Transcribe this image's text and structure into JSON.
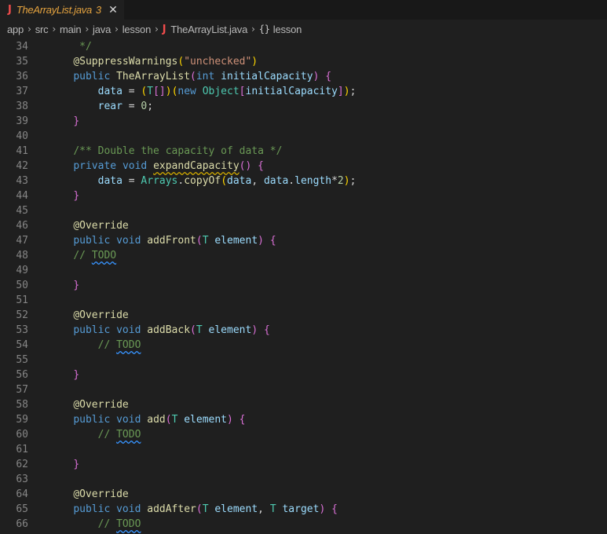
{
  "tab": {
    "icon": "J",
    "title": "TheArrayList.java",
    "problems": "3",
    "close": "✕"
  },
  "breadcrumb": {
    "segments": [
      "app",
      "src",
      "main",
      "java",
      "lesson"
    ],
    "file_icon": "J",
    "file": "TheArrayList.java",
    "symbol_icon": "{}",
    "symbol": "lesson"
  },
  "editor": {
    "lines": [
      {
        "n": "34",
        "t": "     */"
      },
      {
        "n": "35",
        "t": "    @SuppressWarnings(\"unchecked\")"
      },
      {
        "n": "36",
        "t": "    public TheArrayList(int initialCapacity) {"
      },
      {
        "n": "37",
        "t": "        data = (T[])(new Object[initialCapacity]);"
      },
      {
        "n": "38",
        "t": "        rear = 0;"
      },
      {
        "n": "39",
        "t": "    }"
      },
      {
        "n": "40",
        "t": ""
      },
      {
        "n": "41",
        "t": "    /** Double the capacity of data */"
      },
      {
        "n": "42",
        "t": "    private void expandCapacity() {"
      },
      {
        "n": "43",
        "t": "        data = Arrays.copyOf(data, data.length*2);"
      },
      {
        "n": "44",
        "t": "    }"
      },
      {
        "n": "45",
        "t": ""
      },
      {
        "n": "46",
        "t": "    @Override"
      },
      {
        "n": "47",
        "t": "    public void addFront(T element) {"
      },
      {
        "n": "48",
        "t": "    // TODO"
      },
      {
        "n": "49",
        "t": ""
      },
      {
        "n": "50",
        "t": "    }"
      },
      {
        "n": "51",
        "t": ""
      },
      {
        "n": "52",
        "t": "    @Override"
      },
      {
        "n": "53",
        "t": "    public void addBack(T element) {"
      },
      {
        "n": "54",
        "t": "        // TODO"
      },
      {
        "n": "55",
        "t": ""
      },
      {
        "n": "56",
        "t": "    }"
      },
      {
        "n": "57",
        "t": ""
      },
      {
        "n": "58",
        "t": "    @Override"
      },
      {
        "n": "59",
        "t": "    public void add(T element) {"
      },
      {
        "n": "60",
        "t": "        // TODO"
      },
      {
        "n": "61",
        "t": ""
      },
      {
        "n": "62",
        "t": "    }"
      },
      {
        "n": "63",
        "t": ""
      },
      {
        "n": "64",
        "t": "    @Override"
      },
      {
        "n": "65",
        "t": "    public void addAfter(T element, T target) {"
      },
      {
        "n": "66",
        "t": "        // TODO"
      }
    ]
  }
}
